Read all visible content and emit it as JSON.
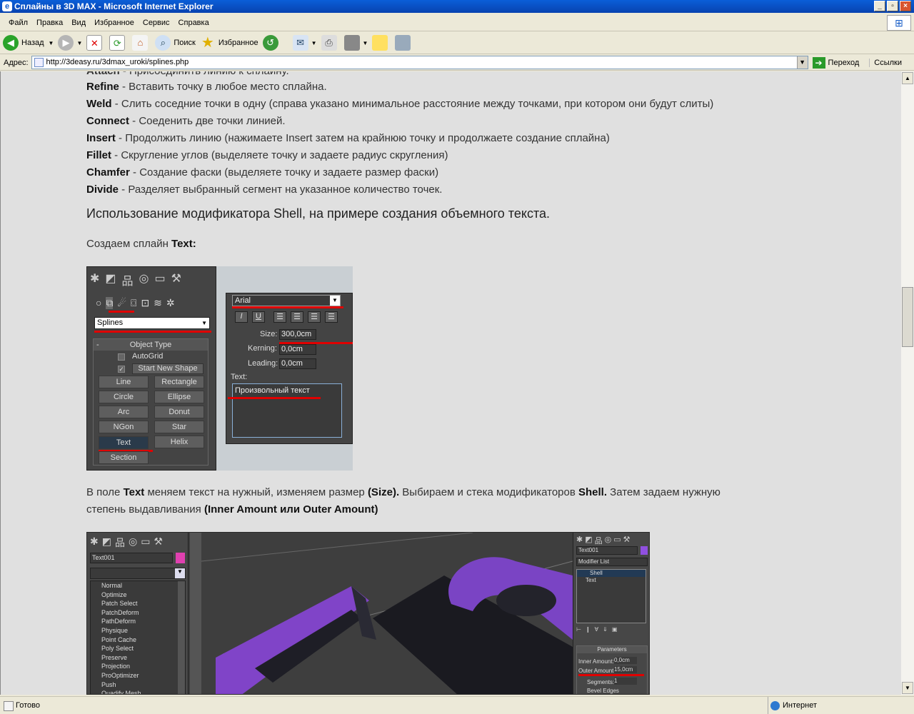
{
  "window": {
    "title": "Сплайны в 3D MAX - Microsoft Internet Explorer"
  },
  "menu": [
    "Файл",
    "Правка",
    "Вид",
    "Избранное",
    "Сервис",
    "Справка"
  ],
  "toolbar": {
    "back": "Назад",
    "search": "Поиск",
    "favorites": "Избранное"
  },
  "address": {
    "label": "Адрес:",
    "url": "http://3deasy.ru/3dmax_uroki/splines.php",
    "go": "Переход",
    "links": "Ссылки"
  },
  "status": {
    "left": "Готово",
    "zone": "Интернет"
  },
  "article": {
    "lines": [
      {
        "term": "Refine",
        "desc": " - Вставить точку в любое место сплайна."
      },
      {
        "term": "Weld",
        "desc": " - Слить соседние точки в одну (справа указано минимальное расстояние между точками, при котором они будут слиты)"
      },
      {
        "term": "Connect",
        "desc": " - Соеденить две точки линией."
      },
      {
        "term": "Insert",
        "desc": " - Продолжить линию (нажимаете Insert затем на крайнюю точку и продолжаете создание сплайна)"
      },
      {
        "term": "Fillet",
        "desc": " - Скругление углов (выделяете точку и задаете радиус скругления)"
      },
      {
        "term": "Chamfer",
        "desc": " - Создание фаски (выделяете точку и задаете размер фаски)"
      },
      {
        "term": "Divide",
        "desc": " - Разделяет выбранный сегмент на указанное количество точек."
      }
    ],
    "heading": "Использование модификатора Shell, на примере создания объемного текста.",
    "p1_a": "Создаем сплайн ",
    "p1_b": "Text:",
    "p2_a": "В поле ",
    "p2_b": "Text",
    "p2_c": " меняем текст на нужный, изменяем размер ",
    "p2_d": "(Size).",
    "p2_e": " Выбираем и стека модификаторов ",
    "p2_f": "Shell.",
    "p2_g": " Затем задаем нужную",
    "p3_a": "степень выдавливания ",
    "p3_b": "(Inner Amount или Outer Amount)"
  },
  "shot1": {
    "dropdown": "Splines",
    "rollout": "Object Type",
    "autogrid": "AutoGrid",
    "startnew": "Start New Shape",
    "buttons": [
      "Line",
      "Rectangle",
      "Circle",
      "Ellipse",
      "Arc",
      "Donut",
      "NGon",
      "Star",
      "Text",
      "Helix",
      "Section"
    ],
    "font": "Arial",
    "size_label": "Size:",
    "size_val": "300,0cm",
    "kerning_label": "Kerning:",
    "kerning_val": "0,0cm",
    "leading_label": "Leading:",
    "leading_val": "0,0cm",
    "text_label": "Text:",
    "text_val": "Произвольный текст"
  },
  "shot2": {
    "objname": "Text001",
    "modifiers": [
      "Normal",
      "Optimize",
      "Patch Select",
      "PatchDeform",
      "PathDeform",
      "Physique",
      "Point Cache",
      "Poly Select",
      "Preserve",
      "Projection",
      "ProOptimizer",
      "Push",
      "Quadify Mesh"
    ],
    "r_objname": "Text001",
    "r_modlist": "Modifier List",
    "stack": [
      "Shell",
      "Text"
    ],
    "params": "Parameters",
    "inner_label": "Inner Amount:",
    "inner_val": "0,0cm",
    "outer_label": "Outer Amount:",
    "outer_val": "15,0cm",
    "seg_label": "Segments:",
    "seg_val": "1",
    "bevel": "Bevel Edges"
  }
}
